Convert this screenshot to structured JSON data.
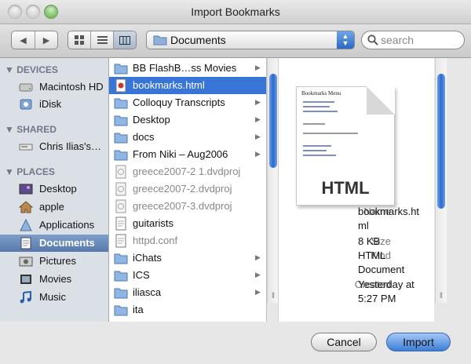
{
  "window": {
    "title": "Import Bookmarks"
  },
  "toolbar": {
    "location": "Documents",
    "search_placeholder": "search",
    "back_glyph": "◀",
    "forward_glyph": "▶"
  },
  "sidebar": {
    "devices_header": "DEVICES",
    "shared_header": "SHARED",
    "places_header": "PLACES",
    "devices": [
      {
        "label": "Macintosh HD",
        "icon": "hard-drive-icon"
      },
      {
        "label": "iDisk",
        "icon": "idisk-icon"
      }
    ],
    "shared": [
      {
        "label": "Chris Ilias's…",
        "icon": "computer-icon"
      }
    ],
    "places": [
      {
        "label": "Desktop",
        "icon": "desktop-icon"
      },
      {
        "label": "apple",
        "icon": "home-icon"
      },
      {
        "label": "Applications",
        "icon": "applications-icon"
      },
      {
        "label": "Documents",
        "icon": "documents-icon"
      },
      {
        "label": "Pictures",
        "icon": "pictures-icon"
      },
      {
        "label": "Movies",
        "icon": "movies-icon"
      },
      {
        "label": "Music",
        "icon": "music-icon"
      }
    ]
  },
  "files": [
    {
      "name": "BB FlashB…ss Movies",
      "type": "folder",
      "chevron": "▶"
    },
    {
      "name": "bookmarks.html",
      "type": "html",
      "selected": true
    },
    {
      "name": "Colloquy Transcripts",
      "type": "folder",
      "chevron": "▶"
    },
    {
      "name": "Desktop",
      "type": "folder",
      "chevron": "▶"
    },
    {
      "name": "docs",
      "type": "folder",
      "chevron": "▶"
    },
    {
      "name": "From Niki – Aug2006",
      "type": "folder",
      "chevron": "▶"
    },
    {
      "name": "greece2007-2 1.dvdproj",
      "type": "dvdproj",
      "dimmed": true
    },
    {
      "name": "greece2007-2.dvdproj",
      "type": "dvdproj",
      "dimmed": true
    },
    {
      "name": "greece2007-3.dvdproj",
      "type": "dvdproj",
      "dimmed": true
    },
    {
      "name": "guitarists",
      "type": "file"
    },
    {
      "name": "httpd.conf",
      "type": "file",
      "dimmed": true
    },
    {
      "name": "iChats",
      "type": "folder",
      "chevron": "▶"
    },
    {
      "name": "ICS",
      "type": "folder",
      "chevron": "▶"
    },
    {
      "name": "iliasca",
      "type": "folder",
      "chevron": "▶"
    },
    {
      "name": "ita",
      "type": "folder"
    }
  ],
  "preview": {
    "doc_title": "Bookmarks Menu",
    "badge": "HTML",
    "meta": [
      {
        "label": "Name",
        "lines": [
          "bookmarks.ht",
          "ml"
        ]
      },
      {
        "label": "Size",
        "lines": [
          "8 KB"
        ]
      },
      {
        "label": "Kind",
        "lines": [
          "HTML",
          "Document"
        ]
      },
      {
        "label": "Created",
        "lines": [
          "Yesterday at",
          "5:27 PM"
        ]
      }
    ]
  },
  "buttons": {
    "cancel": "Cancel",
    "import": "Import"
  },
  "colors": {
    "selection": "#3875d7",
    "sidebar_bg": "#dbe0e7",
    "default_button": "#3c7ed8"
  }
}
